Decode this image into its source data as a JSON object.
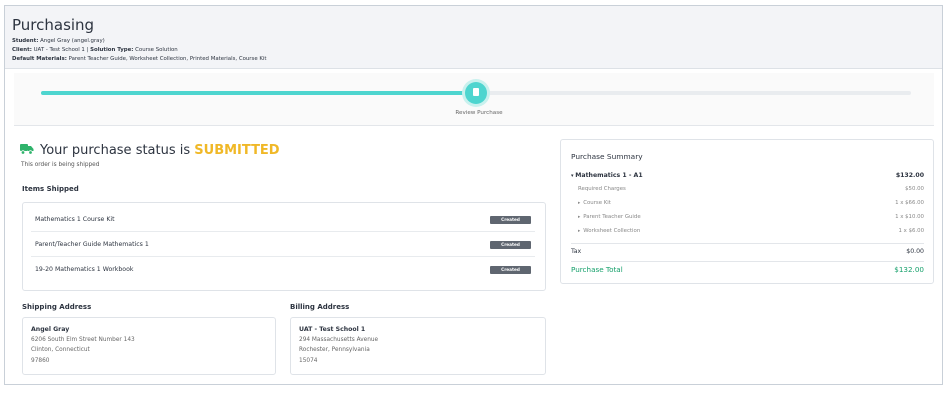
{
  "header": {
    "title": "Purchasing",
    "student_label": "Student:",
    "student_value": "Angel Gray (angel.gray)",
    "client_label": "Client:",
    "client_value": "UAT - Test School 1 |",
    "solution_label": "Solution Type:",
    "solution_value": "Course Solution",
    "materials_label": "Default Materials:",
    "materials_value": "Parent Teacher Guide, Worksheet Collection, Printed Materials, Course Kit"
  },
  "progress": {
    "step_label": "Review Purchase",
    "fill_percent": 50,
    "step_icon": "document-icon",
    "color": "#4ed5cf"
  },
  "status": {
    "icon": "truck-icon",
    "prefix": "Your purchase status is ",
    "state": "SUBMITTED",
    "state_color": "#f0b827",
    "subtext": "This order is being shipped"
  },
  "items_shipped": {
    "title": "Items Shipped",
    "items": [
      {
        "name": "Mathematics 1 Course Kit",
        "badge": "Created"
      },
      {
        "name": "Parent/Teacher Guide Mathematics 1",
        "badge": "Created"
      },
      {
        "name": "19-20 Mathematics 1 Workbook",
        "badge": "Created"
      }
    ]
  },
  "shipping": {
    "title": "Shipping Address",
    "name": "Angel Gray",
    "line1": "6206 South Elm Street Number 143",
    "line2": "Clinton, Connecticut",
    "line3": "97860"
  },
  "billing": {
    "title": "Billing Address",
    "name": "UAT - Test School 1",
    "line1": "294 Massachusetts Avenue",
    "line2": "Rochester, Pennsylvania",
    "line3": "15074"
  },
  "summary": {
    "title": "Purchase Summary",
    "product": {
      "label": "Mathematics 1 - A1",
      "amount": "$132.00",
      "toggle": "caret-down-icon"
    },
    "required": {
      "label": "Required Charges",
      "amount": "$50.00"
    },
    "lines": [
      {
        "label": "Course Kit",
        "amount": "1 x $66.00"
      },
      {
        "label": "Parent Teacher Guide",
        "amount": "1 x $10.00"
      },
      {
        "label": "Worksheet Collection",
        "amount": "1 x $6.00"
      }
    ],
    "tax": {
      "label": "Tax",
      "amount": "$0.00"
    },
    "total": {
      "label": "Purchase Total",
      "amount": "$132.00",
      "color": "#16a06b"
    }
  }
}
